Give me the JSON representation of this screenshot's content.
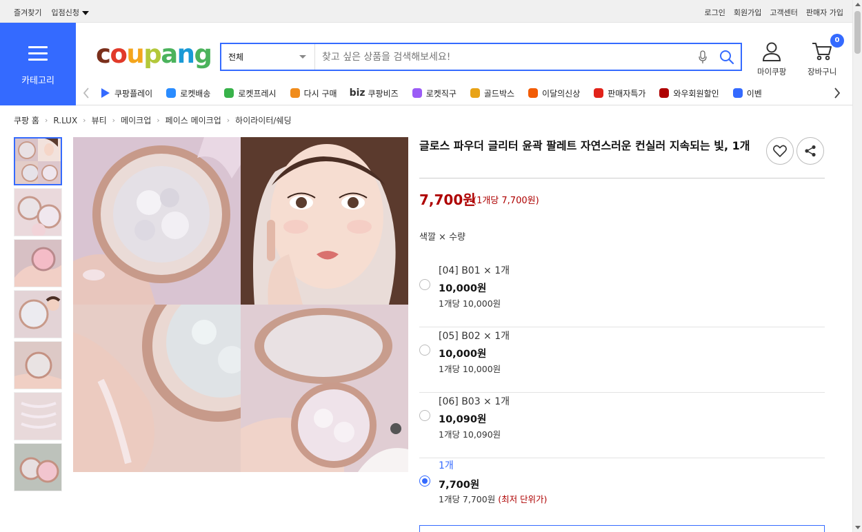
{
  "topbar": {
    "favorites": "즐겨찾기",
    "store_apply": "입점신청",
    "login": "로그인",
    "signup": "회원가입",
    "customer_center": "고객센터",
    "seller_signup": "판매자 가입"
  },
  "header": {
    "category_label": "카테고리",
    "logo_letters": [
      "c",
      "o",
      "u",
      "p",
      "a",
      "n",
      "g"
    ],
    "logo_colors": [
      "#7a2f1b",
      "#e13a2a",
      "#f4a51c",
      "#b3c83a",
      "#4bb35c",
      "#1a9ad6",
      "#4bb35c"
    ],
    "search_category": "전체",
    "search_placeholder": "찾고 싶은 상품을 검색해보세요!",
    "mycoupang": "마이쿠팡",
    "cart": "장바구니",
    "cart_count": "0"
  },
  "nav": {
    "items": [
      {
        "label": "쿠팡플레이",
        "icon": "play-icon"
      },
      {
        "label": "로켓배송",
        "icon": "rocket-icon"
      },
      {
        "label": "로켓프레시",
        "icon": "rocket-fresh-icon"
      },
      {
        "label": "다시 구매",
        "icon": "rebuy-icon"
      },
      {
        "label": "쿠팡비즈",
        "icon": "biz-icon",
        "prefix": "biz"
      },
      {
        "label": "로켓직구",
        "icon": "rocket-global-icon"
      },
      {
        "label": "골드박스",
        "icon": "goldbox-icon"
      },
      {
        "label": "이달의신상",
        "icon": "new-icon"
      },
      {
        "label": "판매자특가",
        "icon": "seller-deal-icon"
      },
      {
        "label": "와우회원할인",
        "icon": "wow-icon"
      },
      {
        "label": "이벤",
        "icon": "event-icon"
      }
    ]
  },
  "breadcrumb": [
    "쿠팡 홈",
    "R.LUX",
    "뷰티",
    "메이크업",
    "페이스 메이크업",
    "하이라이터/쉐딩"
  ],
  "product": {
    "title": "글로스 파우더 글리터 윤곽 팔레트 자연스러운 컨실러 지속되는 빛, 1개",
    "price": "7,700원",
    "unit_price": "(1개당 7,700원)",
    "option_heading": "색깔 × 수량",
    "options": [
      {
        "name": "[04] B01 × 1개",
        "price": "10,000원",
        "per": "1개당 10,000원",
        "selected": false
      },
      {
        "name": "[05] B02 × 1개",
        "price": "10,000원",
        "per": "1개당 10,000원",
        "selected": false
      },
      {
        "name": "[06] B03 × 1개",
        "price": "10,090원",
        "per": "1개당 10,090원",
        "selected": false
      },
      {
        "name": "1개",
        "price": "7,700원",
        "per": "1개당 7,700원",
        "lowest": "(최저 단위가)",
        "selected": true
      }
    ]
  },
  "colors": {
    "accent": "#346aff",
    "price_red": "#ae0000"
  }
}
